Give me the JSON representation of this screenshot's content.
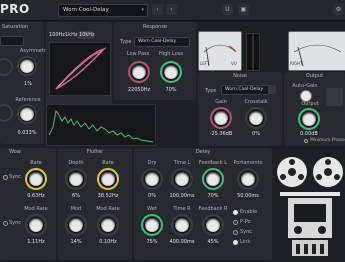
{
  "app": {
    "title": "PRO"
  },
  "toolbar": {
    "preset_name": "Worn Cool-Delay",
    "u_label": "U"
  },
  "saturation": {
    "title": "Saturation",
    "asymmetry_label": "Asymmetry",
    "asymmetry_value": "1%",
    "reference_label": "Reference",
    "reference_value": "0.033%"
  },
  "scope": {
    "tab1": "100Hz",
    "tab2": "1kHz",
    "tab3": "10kHz"
  },
  "response": {
    "title": "Response",
    "type_label": "Type",
    "type_value": "Worn Cool-Delay",
    "lowpass_label": "Low Pass",
    "lowpass_value": "22050Hz",
    "highloss_label": "High Loss",
    "highloss_value": "70%"
  },
  "meters": {
    "left_label": "LEFT",
    "right_label": "RIGHT",
    "vu_label": "VU"
  },
  "noise": {
    "title": "Noise",
    "type_label": "Type",
    "type_value": "Worn Cool-Delay",
    "gain_label": "Gain",
    "gain_value": "-25.36dB",
    "crosstalk_label": "Crosstalk",
    "crosstalk_value": "0%"
  },
  "output": {
    "title": "Output",
    "autogain_label": "Auto-Gain",
    "output_label": "Output",
    "output_value": "0.00dB",
    "minphase_label": "Minimum Phase"
  },
  "wow": {
    "title": "Wow",
    "sync_label": "Sync",
    "rate_label": "Rate",
    "rate_value": "0.63Hz",
    "modrate_label": "Mod Rate",
    "modrate_value": "1.11Hz"
  },
  "flutter": {
    "title": "Flutter",
    "depth_label": "Depth",
    "depth_value": "6%",
    "rate_label": "Rate",
    "rate_value": "38.52Hz",
    "mod_label": "Mod",
    "mod_value": "14%",
    "modrate_label": "Mod Rate",
    "modrate_value": "0.10Hz"
  },
  "delay": {
    "title": "Delay",
    "dry_label": "Dry",
    "dry_value": "0%",
    "timel_label": "Time L",
    "timel_value": "100.00ms",
    "fbl_label": "Feedback L",
    "fbl_value": "70%",
    "portamento_label": "Portamento",
    "portamento_value": "50.00ms",
    "wet_label": "Wet",
    "wet_value": "75%",
    "timer_label": "Time R",
    "timer_value": "400.00ms",
    "fbr_label": "Feedback R",
    "fbr_value": "45%",
    "enable_label": "Enable",
    "pingpong_label": "P-Po",
    "sync_label": "Sync",
    "link_label": "Link"
  },
  "colors": {
    "accent_green": "#3fbf7a",
    "accent_yellow": "#e8c341",
    "accent_pink": "#d4658e"
  }
}
